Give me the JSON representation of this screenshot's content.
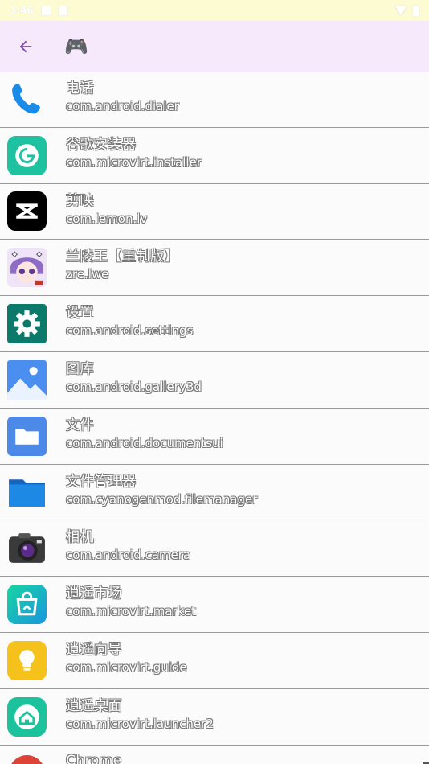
{
  "status_bar": {
    "time": "1:46"
  },
  "app_bar": {
    "title_icon": "🎮",
    "back": "arrow-left-icon"
  },
  "apps": [
    {
      "name": "电话",
      "package": "com.android.dialer",
      "icon": "phone-icon",
      "color": "#1a8ce8"
    },
    {
      "name": "谷歌安装器",
      "package": "com.microvirt.installer",
      "icon": "google-installer-icon",
      "color": "#1fc2a0"
    },
    {
      "name": "剪映",
      "package": "com.lemon.lv",
      "icon": "capcut-icon",
      "color": "#000000"
    },
    {
      "name": "兰陵王【重制版】",
      "package": "zre.lwe",
      "icon": "anime-avatar-icon",
      "color": "#c9a3e6"
    },
    {
      "name": "设置",
      "package": "com.android.settings",
      "icon": "settings-gear-icon",
      "color": "#0b7a6b"
    },
    {
      "name": "图库",
      "package": "com.android.gallery3d",
      "icon": "gallery-icon",
      "color": "#4a8ff0"
    },
    {
      "name": "文件",
      "package": "com.android.documentsui",
      "icon": "folder-icon",
      "color": "#4c89e8"
    },
    {
      "name": "文件管理器",
      "package": "com.cyanogenmod.filemanager",
      "icon": "file-manager-folder-icon",
      "color": "#1a7fd8"
    },
    {
      "name": "相机",
      "package": "com.android.camera",
      "icon": "camera-icon",
      "color": "#3a3a3a"
    },
    {
      "name": "逍遥市场",
      "package": "com.microvirt.market",
      "icon": "market-bag-icon",
      "color": "#1bc7b4"
    },
    {
      "name": "逍遥向导",
      "package": "com.microvirt.guide",
      "icon": "lightbulb-icon",
      "color": "#f5c11b"
    },
    {
      "name": "逍遥桌面",
      "package": "com.microvirt.launcher2",
      "icon": "home-icon",
      "color": "#1cc29b"
    },
    {
      "name": "Chrome",
      "package": "",
      "icon": "chrome-icon",
      "color": "#db4437"
    }
  ]
}
